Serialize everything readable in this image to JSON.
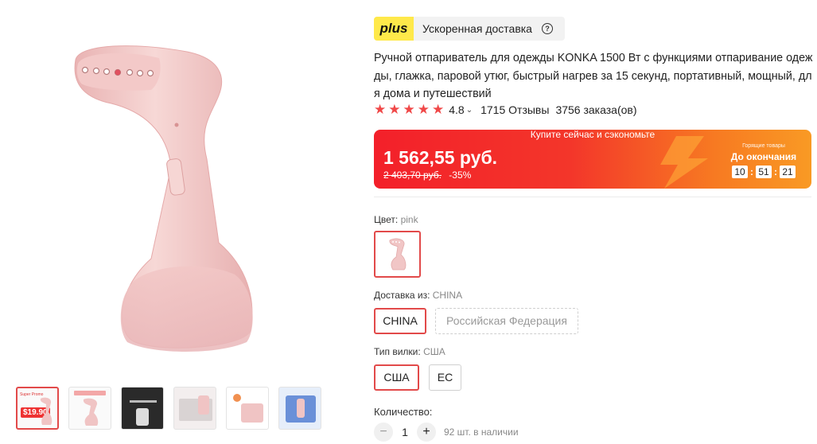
{
  "gallery": {
    "thumbnails": [
      {
        "name": "thumb-promo",
        "promo_title": "Super Promo",
        "promo_price": "$19.90"
      },
      {
        "name": "thumb-2"
      },
      {
        "name": "thumb-3"
      },
      {
        "name": "thumb-4"
      },
      {
        "name": "thumb-5"
      },
      {
        "name": "thumb-6"
      }
    ]
  },
  "delivery_plus": {
    "badge": "plus",
    "text": "Ускоренная доставка",
    "help_icon": "question-circle-icon"
  },
  "product": {
    "title": "Ручной отпариватель для одежды KONKA 1500 Вт с функциями отпаривание одежды, глажка, паровой утюг, быстрый нагрев за 15 секунд, портативный, мощный, для дома и путешествий",
    "rating": "4.8",
    "stars_count": 5,
    "reviews": "1715 Отзывы",
    "orders": "3756 заказа(ов)"
  },
  "price_banner": {
    "top_text": "Купите сейчас и сэкономьте",
    "price": "1 562,55 руб.",
    "old_price": "2 403,70 руб.",
    "discount": "-35%",
    "timer_small_label": "Горящие товары",
    "timer_label": "До окончания",
    "timer": {
      "hours": "10",
      "minutes": "51",
      "seconds": "21"
    }
  },
  "options": {
    "color_label": "Цвет:",
    "color_value": "pink",
    "ship_label": "Доставка из:",
    "ship_value": "CHINA",
    "ship_options": [
      "CHINA",
      "Российская Федерация"
    ],
    "plug_label": "Тип вилки:",
    "plug_value": "США",
    "plug_options": [
      "США",
      "ЕС"
    ]
  },
  "quantity": {
    "label": "Количество:",
    "minus": "−",
    "value": "1",
    "plus": "+",
    "stock": "92 шт. в наличии"
  },
  "colors": {
    "accent_red": "#e24a4a",
    "star": "#f04848",
    "plus_yellow": "#ffe94a",
    "banner_start": "#f3202a",
    "banner_end": "#f99a24"
  }
}
